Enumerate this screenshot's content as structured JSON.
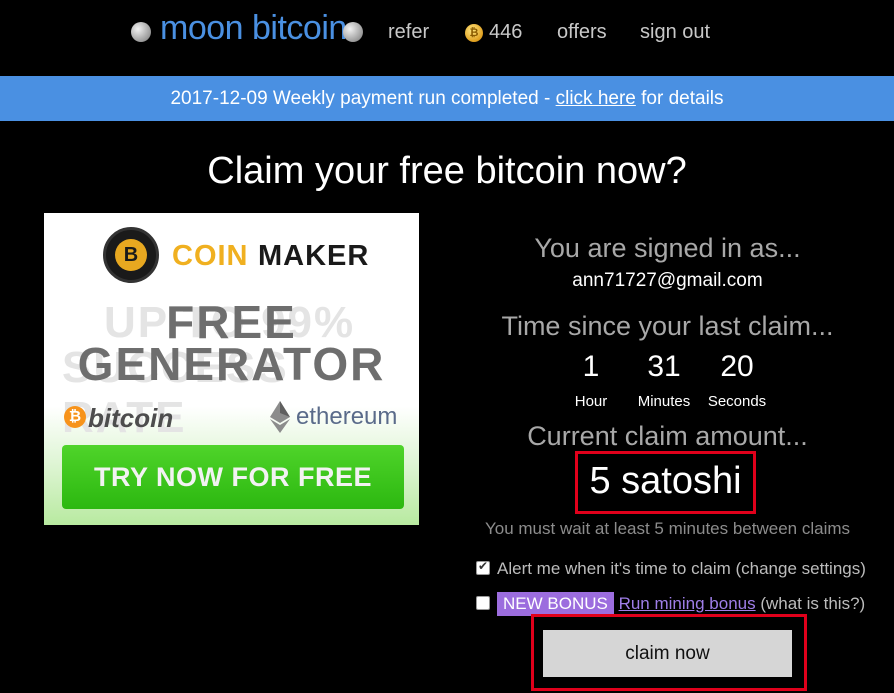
{
  "nav": {
    "brand": "moon bitcoin",
    "refer": "refer",
    "balance": "446",
    "offers": "offers",
    "sign_out": "sign out"
  },
  "banner": {
    "prefix": "2017-12-09 Weekly payment run completed - ",
    "link": "click here",
    "suffix": " for details"
  },
  "heading": "Claim your free bitcoin now?",
  "ad": {
    "coin": "COIN",
    "maker": "MAKER",
    "ghost_line1": "UP TO 99%",
    "ghost_line2": "SUCCESS RATE",
    "free": "FREE",
    "generator": "GENERATOR",
    "bitcoin": "bitcoin",
    "ethereum": "ethereum",
    "try": "TRY NOW FOR FREE"
  },
  "account": {
    "signed_in_label": "You are signed in as...",
    "email": "ann71727@gmail.com"
  },
  "timer": {
    "label": "Time since your last claim...",
    "hours": "1",
    "minutes": "31",
    "seconds": "20",
    "hours_label": "Hour",
    "minutes_label": "Minutes",
    "seconds_label": "Seconds"
  },
  "claim": {
    "amount_label": "Current claim amount...",
    "amount": "5 satoshi",
    "wait_note": "You must wait at least 5 minutes between claims",
    "button": "claim now"
  },
  "options": {
    "alert_text": "Alert me when it's time to claim ",
    "alert_settings": "(change settings)",
    "alert_checked": true,
    "bonus_badge": "NEW BONUS",
    "bonus_link": "Run mining bonus",
    "bonus_help": " (what is this?)",
    "bonus_checked": false
  },
  "colors": {
    "brand": "#4a90e2",
    "highlight_border": "#e0001b",
    "bonus_badge": "#9c6dde"
  }
}
